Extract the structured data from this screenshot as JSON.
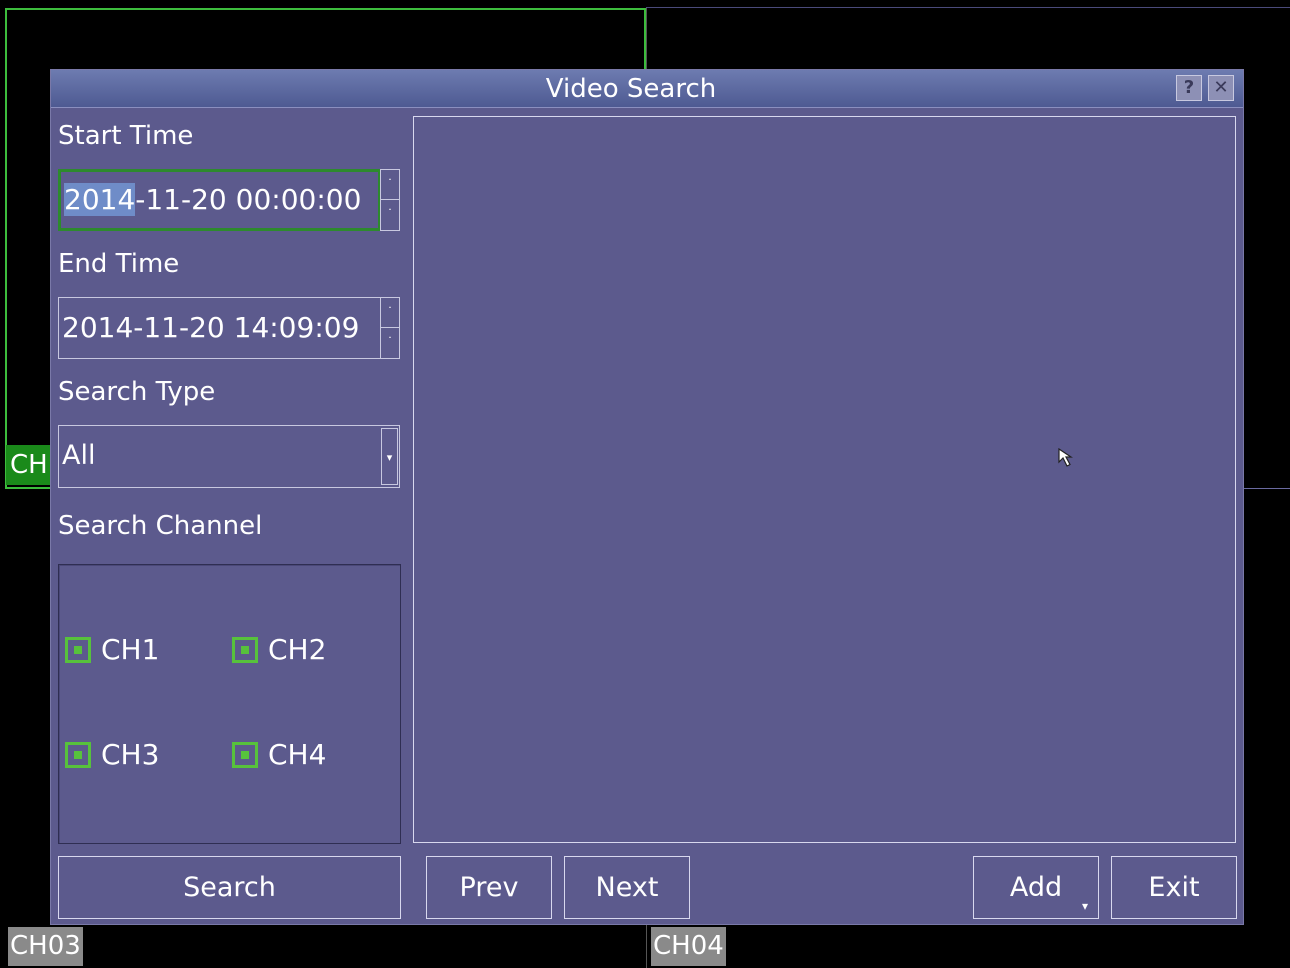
{
  "background": {
    "ch1_label": "CH",
    "ch3_label": "CH03",
    "ch4_label": "CH04"
  },
  "dialog": {
    "title": "Video Search",
    "help_icon": "?",
    "close_icon": "✕"
  },
  "start_time": {
    "label": "Start Time",
    "selected_part": "2014",
    "value_rest": "-11-20 00:00:00"
  },
  "end_time": {
    "label": "End Time",
    "value": "2014-11-20 14:09:09"
  },
  "search_type": {
    "label": "Search Type",
    "value": "All"
  },
  "search_channel": {
    "label": "Search Channel",
    "channels": [
      {
        "label": "CH1",
        "checked": true
      },
      {
        "label": "CH2",
        "checked": true
      },
      {
        "label": "CH3",
        "checked": true
      },
      {
        "label": "CH4",
        "checked": true
      }
    ]
  },
  "buttons": {
    "search": "Search",
    "prev": "Prev",
    "next": "Next",
    "add": "Add",
    "exit": "Exit"
  },
  "spin_up": "˙",
  "spin_down": "˙",
  "dropdown_arrow": "▾",
  "colors": {
    "dialog_bg": "#5c5a8d",
    "focus_border": "#2d8a2d",
    "checkbox": "#57c23c",
    "ch1_label_bg": "#1a8a1a"
  }
}
